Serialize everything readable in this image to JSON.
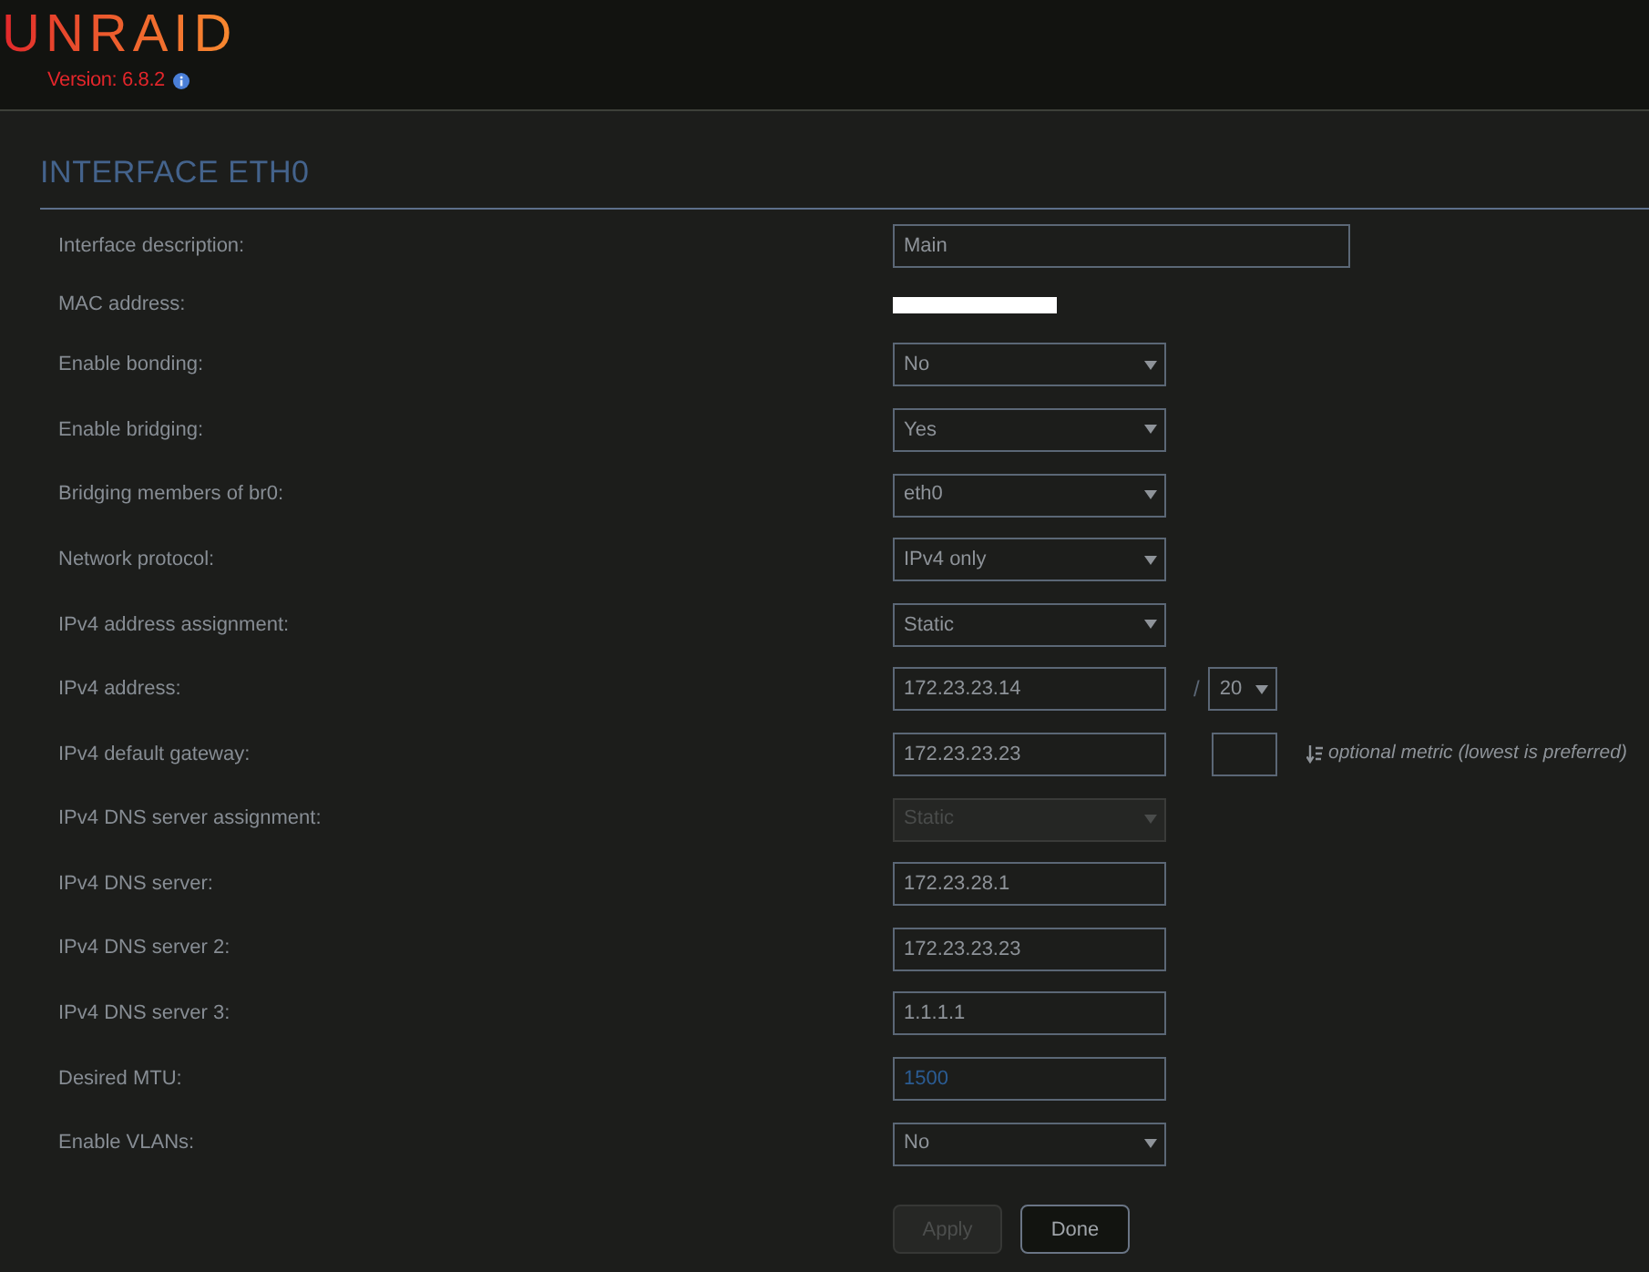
{
  "header": {
    "logo": "UNRAID",
    "version": "Version: 6.8.2"
  },
  "section": {
    "title": "INTERFACE ETH0"
  },
  "rows": [
    {
      "label": "Interface description:",
      "kind": "wide_text",
      "value": "Main"
    },
    {
      "label": "MAC address:",
      "kind": "redacted"
    },
    {
      "label": "Enable bonding:",
      "kind": "select",
      "value": "No",
      "disabled": false
    },
    {
      "label": "Enable bridging:",
      "kind": "select",
      "value": "Yes",
      "disabled": false
    },
    {
      "label": "Bridging members of br0:",
      "kind": "select",
      "value": "eth0",
      "disabled": false
    },
    {
      "label": "Network protocol:",
      "kind": "select",
      "value": "IPv4 only",
      "disabled": false
    },
    {
      "label": "IPv4 address assignment:",
      "kind": "select",
      "value": "Static",
      "disabled": false
    },
    {
      "label": "IPv4 address:",
      "kind": "address",
      "value": "172.23.23.14",
      "separator": "/",
      "prefix": "20"
    },
    {
      "label": "IPv4 default gateway:",
      "kind": "gateway",
      "value": "172.23.23.23",
      "metric_hint": "optional metric (lowest is preferred)"
    },
    {
      "label": "IPv4 DNS server assignment:",
      "kind": "select",
      "value": "Static",
      "disabled": true
    },
    {
      "label": "IPv4 DNS server:",
      "kind": "text",
      "value": "172.23.28.1"
    },
    {
      "label": "IPv4 DNS server 2:",
      "kind": "text",
      "value": "172.23.23.23"
    },
    {
      "label": "IPv4 DNS server 3:",
      "kind": "text",
      "value": "1.1.1.1"
    },
    {
      "label": "Desired MTU:",
      "kind": "text",
      "placeholder": "1500"
    },
    {
      "label": "Enable VLANs:",
      "kind": "select",
      "value": "No",
      "disabled": false
    }
  ],
  "buttons": [
    {
      "label": "Apply",
      "disabled": true
    },
    {
      "label": "Done",
      "disabled": false
    }
  ]
}
